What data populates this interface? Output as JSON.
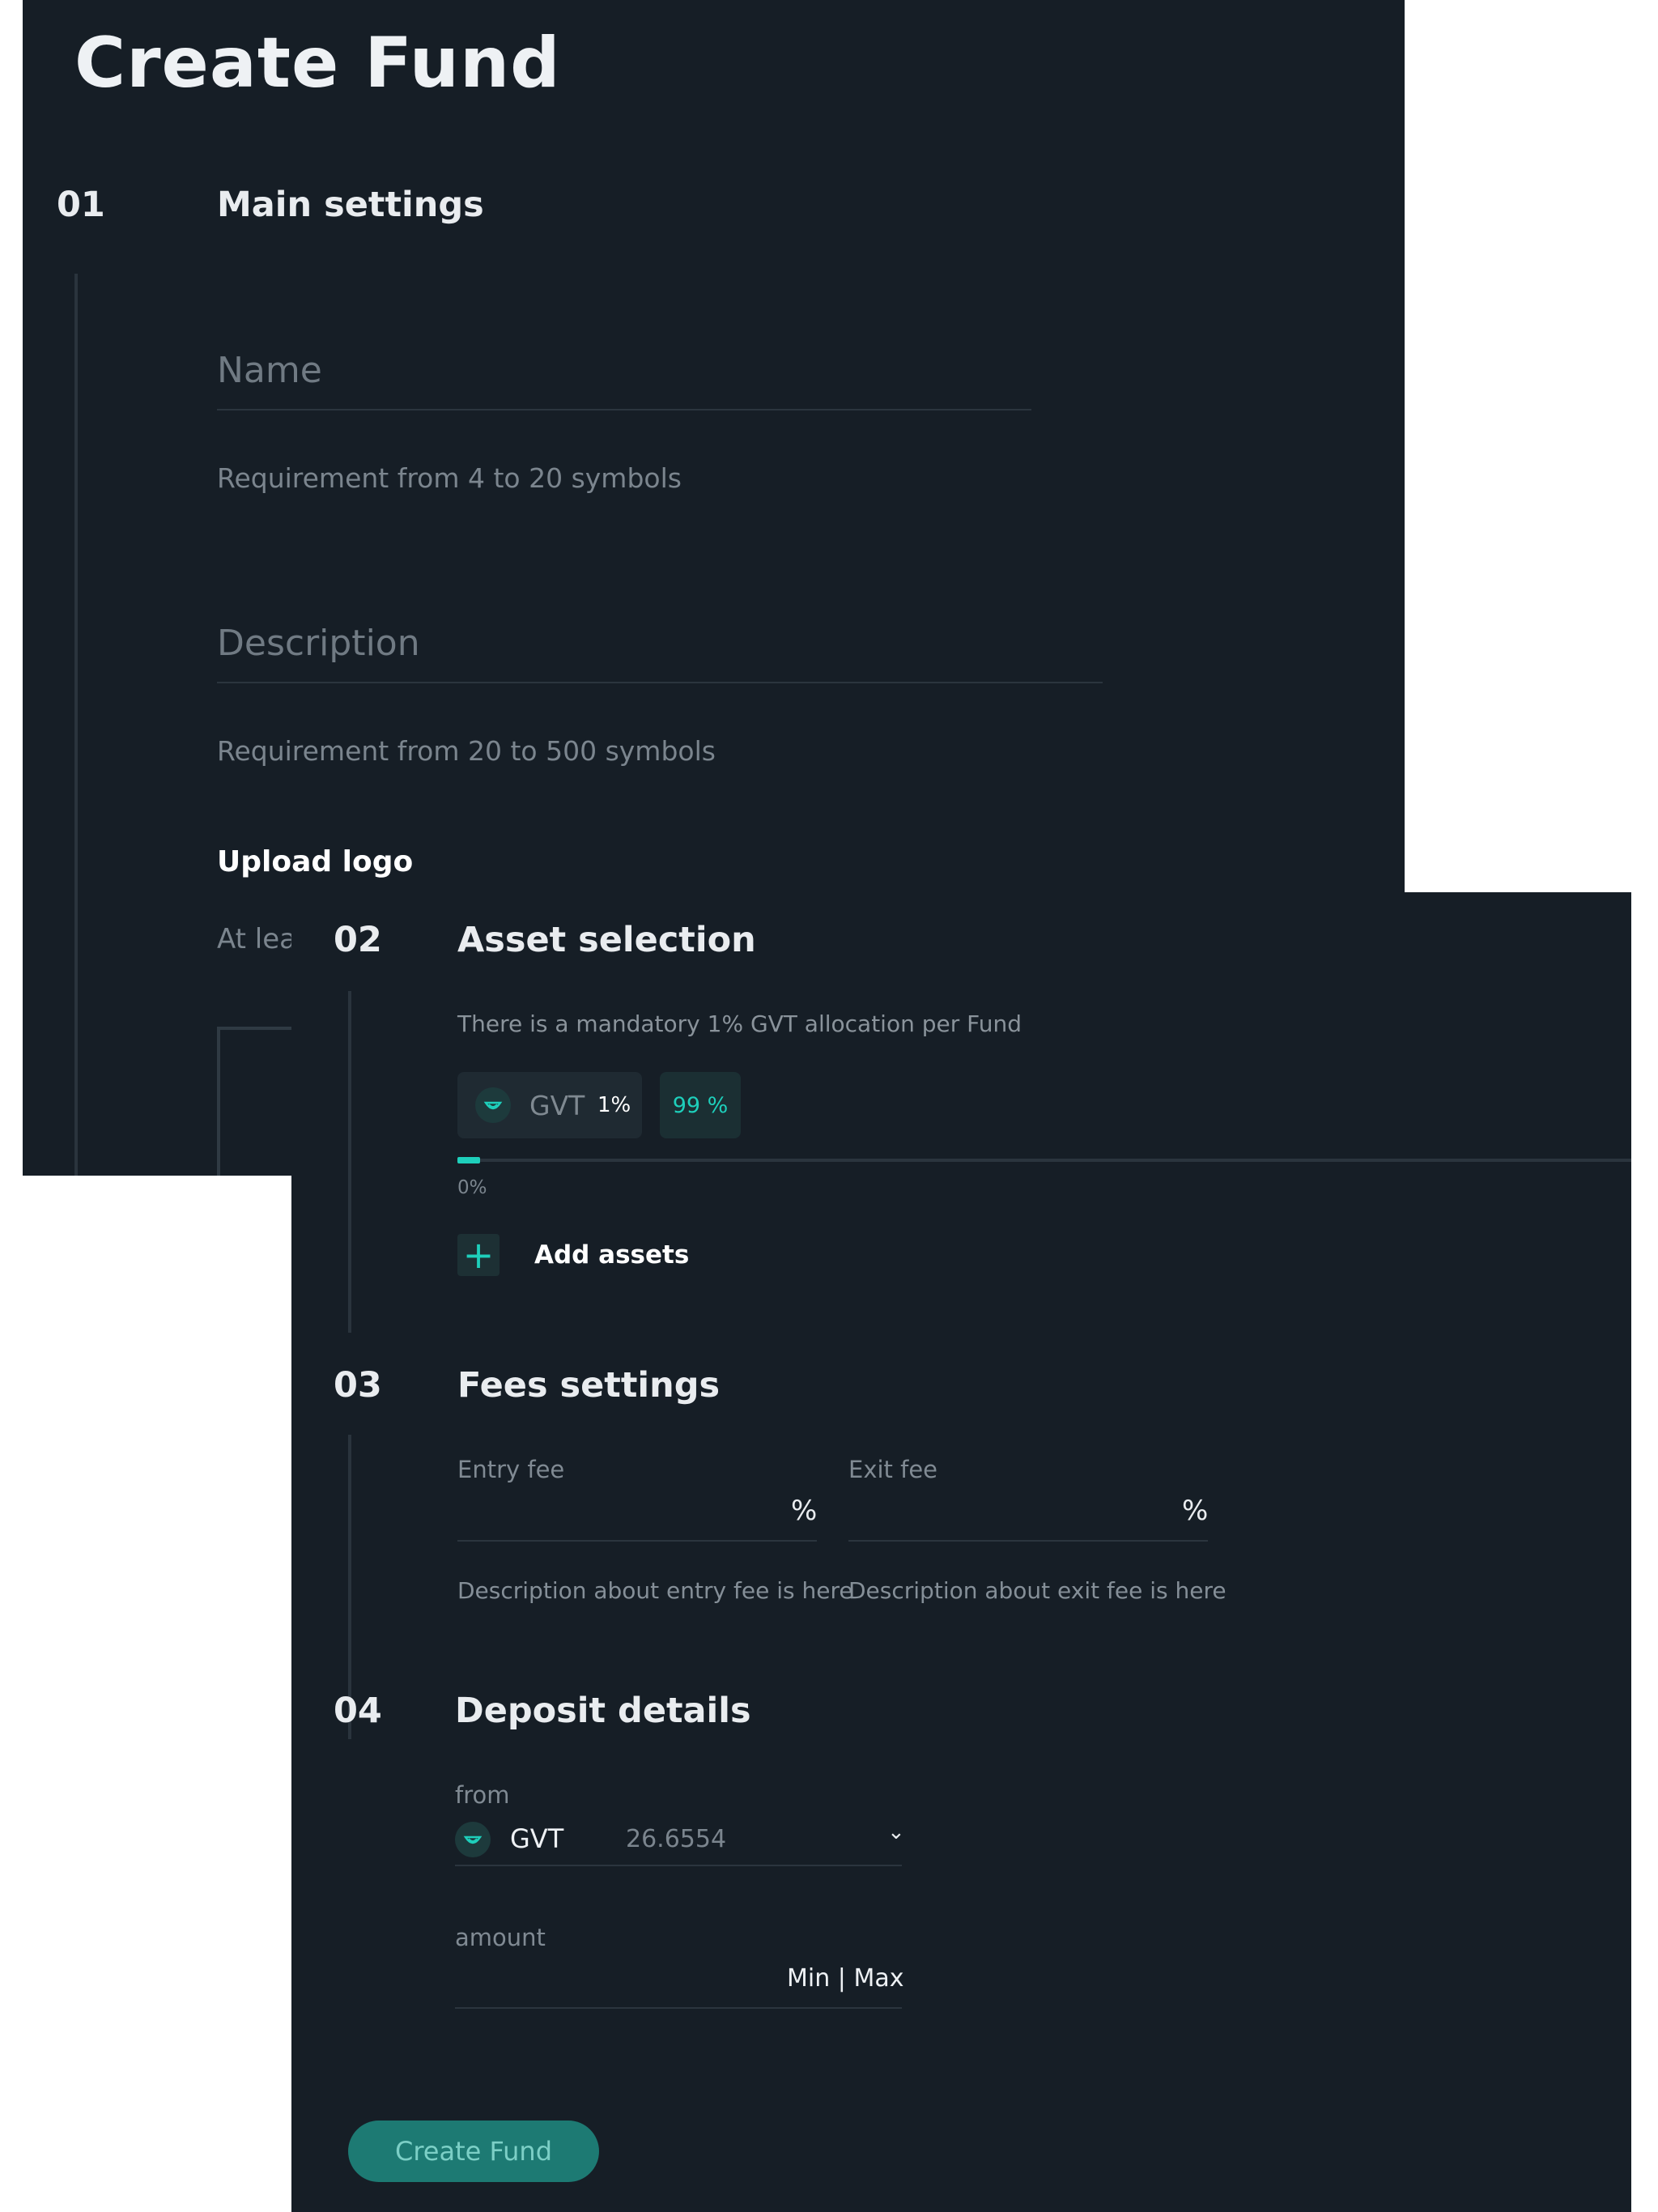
{
  "page": {
    "title": "Create Fund"
  },
  "steps": {
    "main": {
      "number": "01",
      "title": "Main settings",
      "name": {
        "placeholder": "Name",
        "hint": "Requirement from 4 to 20 symbols"
      },
      "description": {
        "placeholder": "Description",
        "hint": "Requirement from 20 to 500 symbols"
      },
      "upload": {
        "title": "Upload logo",
        "hint": "At lea"
      }
    },
    "assets": {
      "number": "02",
      "title": "Asset selection",
      "note": "There is a mandatory 1% GVT allocation per Fund",
      "chip": {
        "symbol": "GVT",
        "percent": "1%"
      },
      "remaining": "99 %",
      "progress": {
        "label": "0%",
        "fraction": 0.01
      },
      "add_label": "Add assets",
      "add_symbol": "+"
    },
    "fees": {
      "number": "03",
      "title": "Fees settings",
      "entry": {
        "label": "Entry fee",
        "unit": "%",
        "hint": "Description about entry fee is here"
      },
      "exit": {
        "label": "Exit fee",
        "unit": "%",
        "hint": "Description about exit fee is here"
      }
    },
    "deposit": {
      "number": "04",
      "title": "Deposit details",
      "from": {
        "label": "from",
        "currency": "GVT",
        "balance": "26.6554",
        "chevron": "⌄"
      },
      "amount": {
        "label": "amount",
        "min": "Min",
        "separator": "|",
        "max": "Max"
      }
    }
  },
  "submit": {
    "label": "Create Fund"
  },
  "colors": {
    "background": "#161e26",
    "accent": "#1ecfbb",
    "button": "#1d7a73"
  },
  "icons": {
    "coin": "gvt-coin-icon",
    "add": "plus-icon",
    "dropdown": "chevron-down-icon"
  }
}
